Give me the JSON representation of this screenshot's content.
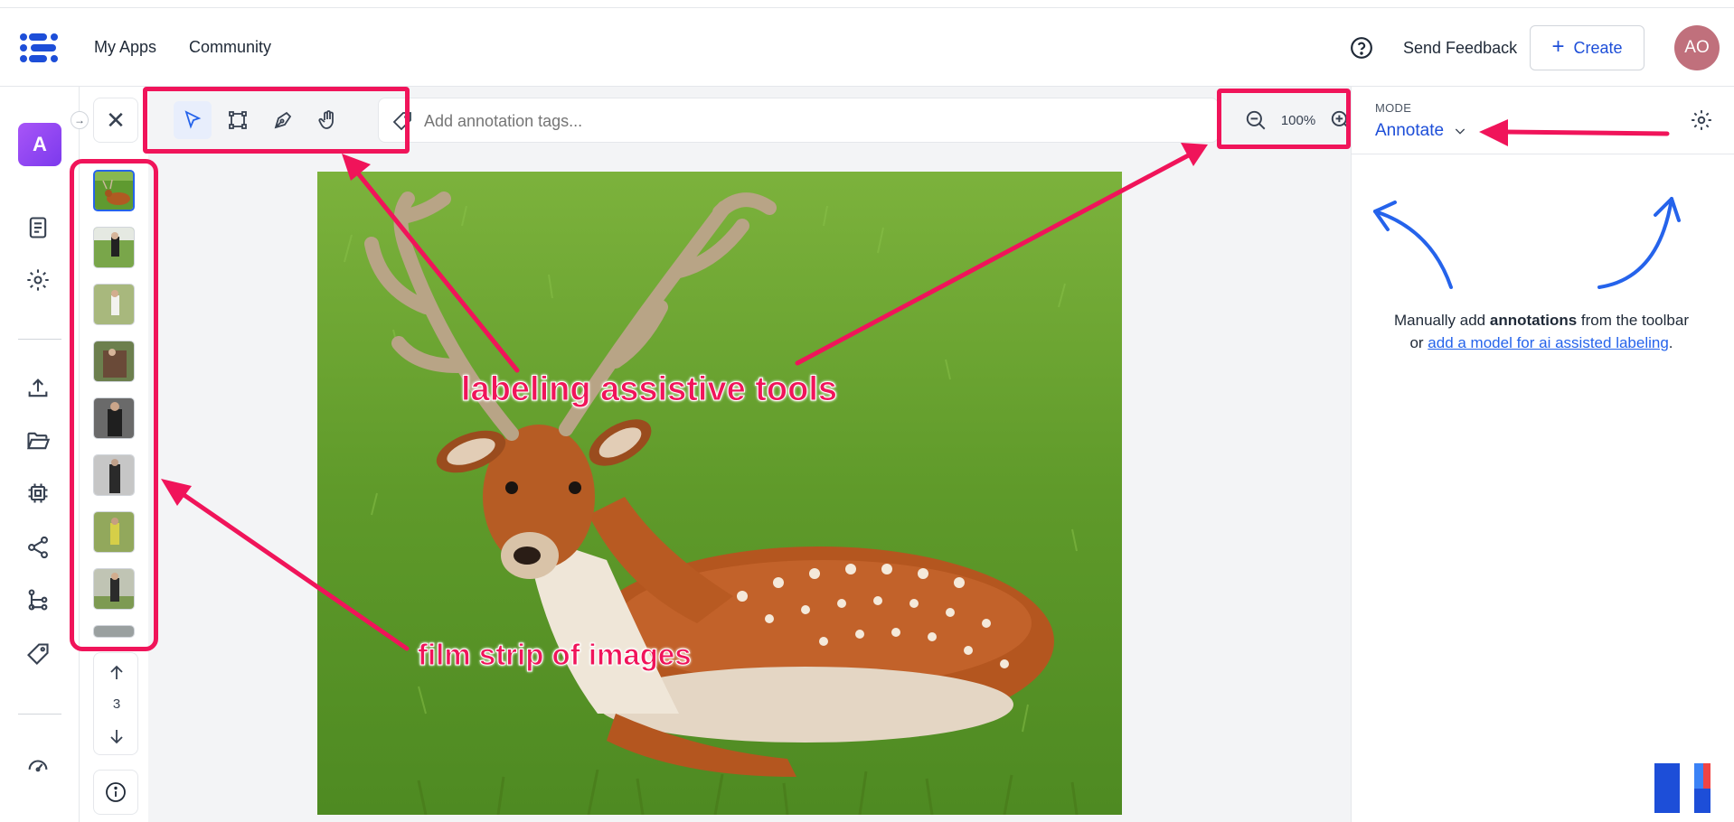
{
  "nav": {
    "links": [
      "My Apps",
      "Community"
    ],
    "send_feedback": "Send Feedback",
    "create_label": "Create",
    "create_icon": "plus-icon",
    "avatar_initials": "AO",
    "avatar_color": "#c0707c"
  },
  "rail": {
    "app_initial": "A",
    "items": [
      "document-icon",
      "gear-icon",
      "upload-icon",
      "folder-icon",
      "chip-icon",
      "share-icon",
      "workflow-icon",
      "tag-icon",
      "speedometer-icon"
    ]
  },
  "filmstrip": {
    "thumbnail_count": 9,
    "active_index": 0,
    "page_number": "3"
  },
  "toolbar": {
    "tools": [
      "select-tool",
      "bounding-box-tool",
      "polygon-pen-tool",
      "pan-hand-tool"
    ],
    "active_tool": "select-tool",
    "tag_placeholder": "Add annotation tags...",
    "zoom_level": "100%"
  },
  "right_panel": {
    "mode_label": "MODE",
    "mode_value": "Annotate",
    "empty_pre": "Manually add ",
    "empty_bold": "annotations",
    "empty_mid": " from the toolbar or ",
    "empty_link": "add a model for ai assisted labeling",
    "empty_post": "."
  },
  "annotations": {
    "tools_label": "labeling assistive tools",
    "filmstrip_label": "film strip of images",
    "highlight_color": "#f0145a"
  },
  "colors": {
    "accent": "#1d4ed8",
    "link": "#2563eb"
  }
}
